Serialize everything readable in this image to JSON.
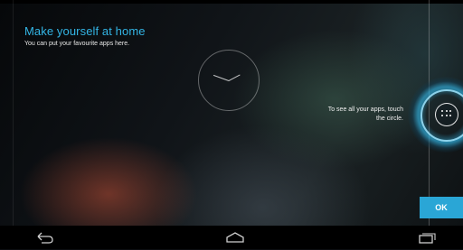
{
  "setup": {
    "title": "Make yourself at home",
    "subtitle": "You can put your favourite apps here."
  },
  "hint": {
    "line1": "To see all your apps, touch",
    "line2": "the circle."
  },
  "ok_label": "OK",
  "icons": {
    "all_apps": "all-apps-icon",
    "back": "back-icon",
    "home": "home-icon",
    "recent": "recent-apps-icon",
    "clock": "analog-clock"
  },
  "colors": {
    "accent": "#33b5e5",
    "ok_button": "#2aa6d6"
  }
}
